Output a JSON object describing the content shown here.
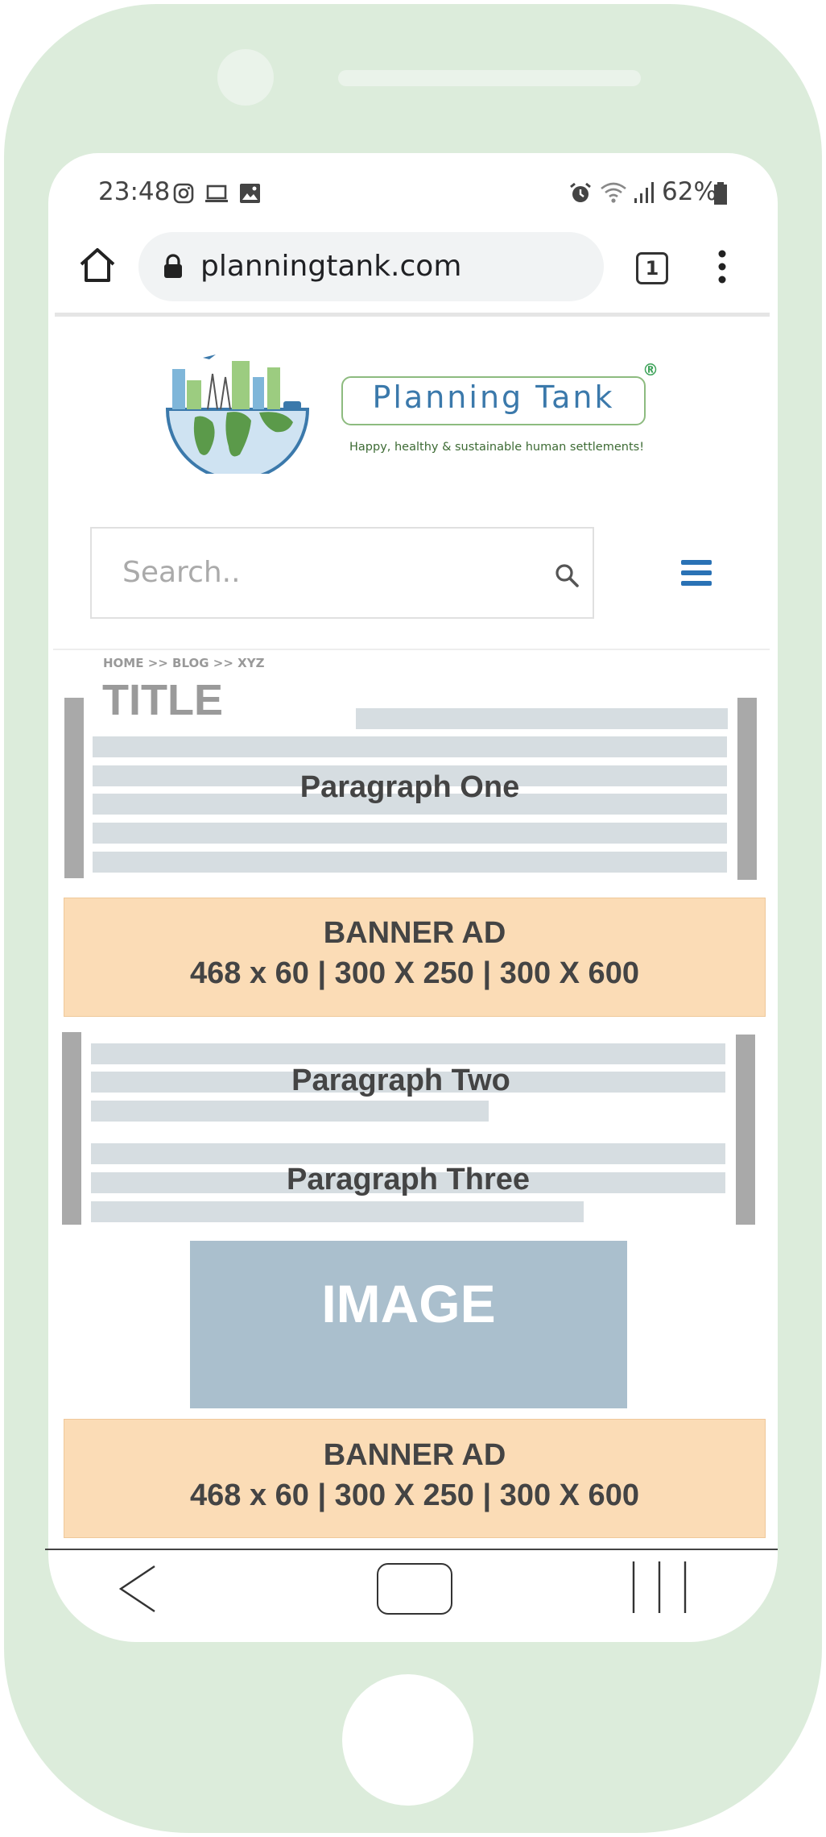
{
  "status_bar": {
    "time": "23:48",
    "battery": "62%",
    "icons": [
      "instagram-icon",
      "laptop-icon",
      "image-icon",
      "alarm-icon",
      "wifi-icon",
      "signal-icon",
      "battery-icon"
    ]
  },
  "browser": {
    "url": "planningtank.com",
    "tab_count": "1"
  },
  "site": {
    "brand_name": "Planning Tank",
    "registered_mark": "®",
    "tagline": "Happy, healthy & sustainable human settlements!",
    "search_placeholder": "Search.."
  },
  "content": {
    "breadcrumb": "HOME >> BLOG >> XYZ",
    "title": "TITLE",
    "paragraph_one": "Paragraph One",
    "banner_1": {
      "line1": "BANNER AD",
      "line2": "468 x 60 | 300 X 250 | 300 X 600"
    },
    "paragraph_two": "Paragraph Two",
    "paragraph_three": "Paragraph Three",
    "image_label": "IMAGE",
    "banner_2": {
      "line1": "BANNER AD",
      "line2": "468 x 60 | 300 X 250 | 300 X 600"
    }
  },
  "colors": {
    "phone_frame": "#dcecdb",
    "banner": "#fbdcb6",
    "image_placeholder": "#aabfcd",
    "placeholder_line": "#d6dde1",
    "accent_blue": "#2a72b5"
  }
}
